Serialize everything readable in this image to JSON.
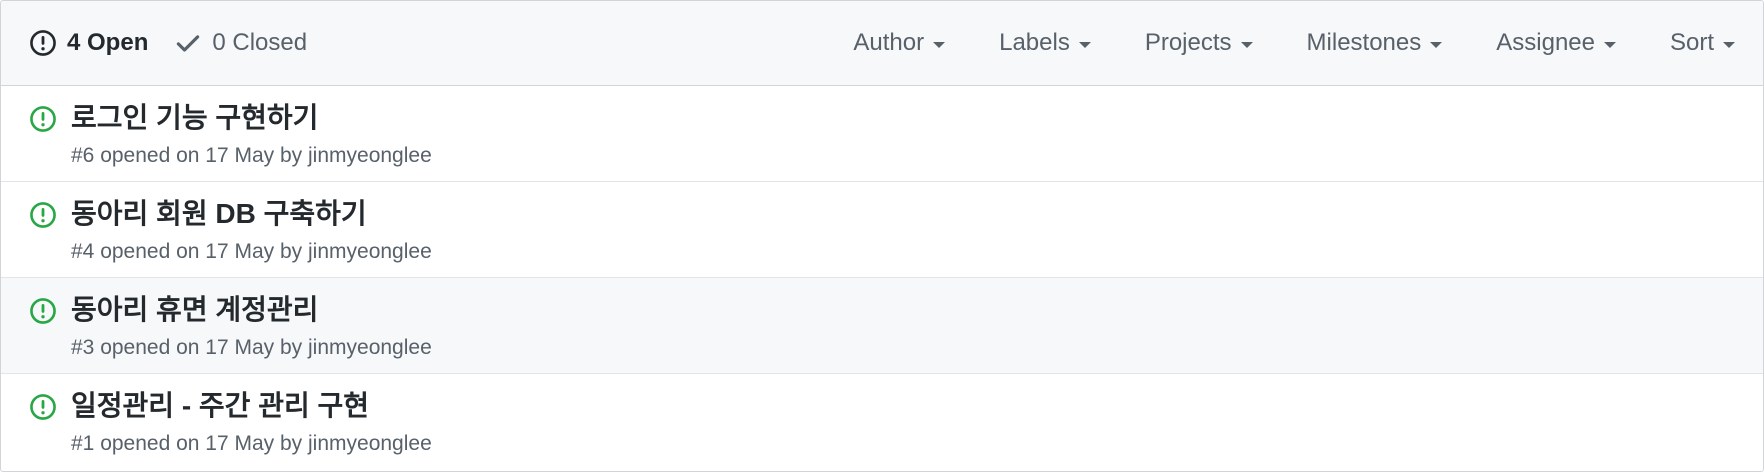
{
  "header": {
    "open_label": "4 Open",
    "closed_label": "0 Closed",
    "filters": [
      "Author",
      "Labels",
      "Projects",
      "Milestones",
      "Assignee",
      "Sort"
    ]
  },
  "issues": [
    {
      "title": "로그인 기능 구현하기",
      "number_opened": "#6 opened on 17 May by",
      "author": "jinmyeonglee"
    },
    {
      "title": "동아리 회원 DB 구축하기",
      "number_opened": "#4 opened on 17 May by",
      "author": "jinmyeonglee"
    },
    {
      "title": "동아리 휴면 계정관리",
      "number_opened": "#3 opened on 17 May by",
      "author": "jinmyeonglee"
    },
    {
      "title": "일정관리 - 주간 관리 구현",
      "number_opened": "#1 opened on 17 May by",
      "author": "jinmyeonglee"
    }
  ],
  "icons": {
    "open_state": "issue-opened-icon",
    "closed_state": "check-icon",
    "filter_caret": "triangle-down-icon",
    "issue_status": "issue-opened-icon"
  },
  "colors": {
    "open_issue_green": "#28a745",
    "header_bg": "#f6f8fa",
    "muted_text": "#586069",
    "border": "#d1d5da"
  }
}
